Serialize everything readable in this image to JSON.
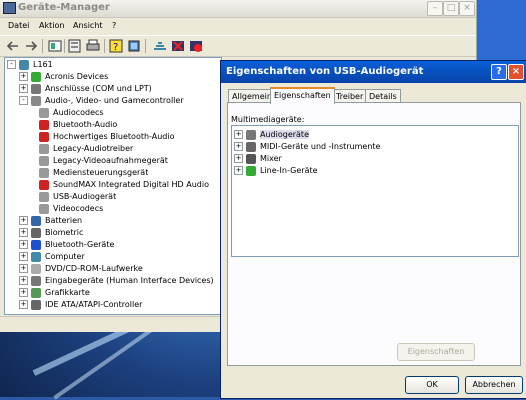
{
  "main_window": {
    "title": "Geräte-Manager",
    "menu": [
      "Datei",
      "Aktion",
      "Ansicht",
      "?"
    ],
    "tree": {
      "root": "L161",
      "items": [
        {
          "label": "Acronis Devices",
          "level": 1,
          "expander": "+",
          "icon": "device-icon"
        },
        {
          "label": "Anschlüsse (COM und LPT)",
          "level": 1,
          "expander": "+",
          "icon": "port-icon"
        },
        {
          "label": "Audio-, Video- und Gamecontroller",
          "level": 1,
          "expander": "-",
          "icon": "audio-icon"
        },
        {
          "label": "Audiocodecs",
          "level": 2,
          "icon": "audio-device-icon"
        },
        {
          "label": "Bluetooth-Audio",
          "level": 2,
          "icon": "audio-disabled-icon"
        },
        {
          "label": "Hochwertiges Bluetooth-Audio",
          "level": 2,
          "icon": "audio-disabled-icon"
        },
        {
          "label": "Legacy-Audiotreiber",
          "level": 2,
          "icon": "audio-device-icon"
        },
        {
          "label": "Legacy-Videoaufnahmegerät",
          "level": 2,
          "icon": "audio-device-icon"
        },
        {
          "label": "Mediensteuerungsgerät",
          "level": 2,
          "icon": "audio-device-icon"
        },
        {
          "label": "SoundMAX Integrated Digital HD Audio",
          "level": 2,
          "icon": "audio-disabled-icon"
        },
        {
          "label": "USB-Audiogerät",
          "level": 2,
          "icon": "audio-device-icon"
        },
        {
          "label": "Videocodecs",
          "level": 2,
          "icon": "audio-device-icon"
        },
        {
          "label": "Batterien",
          "level": 1,
          "expander": "+",
          "icon": "battery-icon"
        },
        {
          "label": "Biometric",
          "level": 1,
          "expander": "+",
          "icon": "biometric-icon"
        },
        {
          "label": "Bluetooth-Geräte",
          "level": 1,
          "expander": "+",
          "icon": "bluetooth-icon"
        },
        {
          "label": "Computer",
          "level": 1,
          "expander": "+",
          "icon": "computer-icon"
        },
        {
          "label": "DVD/CD-ROM-Laufwerke",
          "level": 1,
          "expander": "+",
          "icon": "dvd-icon"
        },
        {
          "label": "Eingabegeräte (Human Interface Devices)",
          "level": 1,
          "expander": "+",
          "icon": "hid-icon"
        },
        {
          "label": "Grafikkarte",
          "level": 1,
          "expander": "+",
          "icon": "display-icon"
        },
        {
          "label": "IDE ATA/ATAPI-Controller",
          "level": 1,
          "expander": "+",
          "icon": "ide-icon"
        }
      ]
    }
  },
  "dialog": {
    "title": "Eigenschaften von USB-Audiogerät",
    "tabs": [
      "Allgemein",
      "Eigenschaften",
      "Treiber",
      "Details"
    ],
    "active_tab": "Eigenschaften",
    "group_label": "Multimediageräte:",
    "list": [
      {
        "label": "Audiogeräte",
        "selected": true,
        "icon": "speaker-icon"
      },
      {
        "label": "MIDI-Geräte und -Instrumente",
        "icon": "midi-icon"
      },
      {
        "label": "Mixer",
        "icon": "mixer-icon"
      },
      {
        "label": "Line-In-Geräte",
        "icon": "line-in-icon"
      }
    ],
    "properties_button": "Eigenschaften",
    "ok_button": "OK",
    "cancel_button": "Abbrechen"
  }
}
